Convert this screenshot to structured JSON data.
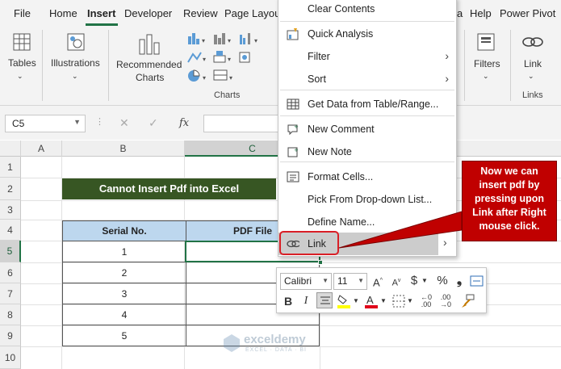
{
  "ribbon": {
    "tabs": [
      "File",
      "Home",
      "Insert",
      "Developer",
      "Review",
      "Page Layou",
      "a",
      "Help",
      "Power Pivot"
    ],
    "active_tab": "Insert",
    "buttons": {
      "tables": "Tables",
      "illustrations": "Illustrations",
      "recommended_charts_1": "Recommended",
      "recommended_charts_2": "Charts",
      "filters": "Filters",
      "link": "Link"
    },
    "group_labels": {
      "charts": "Charts",
      "links": "Links"
    }
  },
  "formula_bar": {
    "name_box": "C5",
    "fx": "fx",
    "value": ""
  },
  "grid": {
    "columns": [
      "A",
      "B",
      "C"
    ],
    "rows": [
      "1",
      "2",
      "3",
      "4",
      "5",
      "6",
      "7",
      "8",
      "9",
      "10"
    ],
    "selected_column": "C",
    "selected_row": "5",
    "title": "Cannot Insert Pdf into Excel",
    "table": {
      "headers": [
        "Serial No.",
        "PDF File"
      ],
      "rows": [
        [
          "1",
          ""
        ],
        [
          "2",
          ""
        ],
        [
          "3",
          ""
        ],
        [
          "4",
          ""
        ],
        [
          "5",
          ""
        ]
      ]
    }
  },
  "context_menu": {
    "items": [
      {
        "label": "Clear Contents",
        "icon": "none"
      },
      {
        "label": "Quick Analysis",
        "icon": "quick-analysis-icon"
      },
      {
        "label": "Filter",
        "icon": "none",
        "submenu": true
      },
      {
        "label": "Sort",
        "icon": "none",
        "submenu": true
      },
      {
        "label": "Get Data from Table/Range...",
        "icon": "table-icon"
      },
      {
        "label": "New Comment",
        "icon": "new-comment-icon"
      },
      {
        "label": "New Note",
        "icon": "new-note-icon"
      },
      {
        "label": "Format Cells...",
        "icon": "format-cells-icon"
      },
      {
        "label": "Pick From Drop-down List...",
        "icon": "none"
      },
      {
        "label": "Define Name...",
        "icon": "none"
      },
      {
        "label": "Link",
        "icon": "link-icon",
        "submenu": true,
        "highlighted": true
      }
    ]
  },
  "callout": {
    "lines": [
      "Now we can",
      "insert pdf by",
      "pressing upon",
      "Link after Right",
      "mouse click."
    ]
  },
  "mini_toolbar": {
    "font": "Calibri",
    "size": "11",
    "currency": "$",
    "percent": "%",
    "comma": "❟",
    "bold": "B",
    "italic": "I"
  },
  "watermark": {
    "name": "exceldemy",
    "tagline": "EXCEL · DATA · BI"
  },
  "colors": {
    "accent": "#217346",
    "title_fill": "#375623",
    "header_fill": "#BDD7EE",
    "callout": "#C00000",
    "highlight": "#D91F26"
  }
}
